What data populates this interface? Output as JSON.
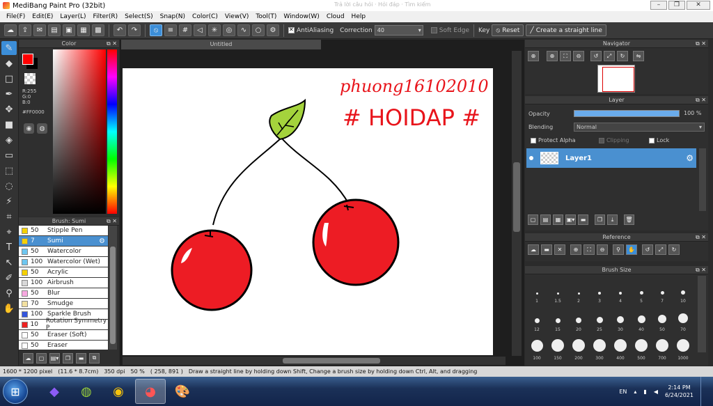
{
  "window": {
    "title": "MediBang Paint Pro (32bit)",
    "ghost_text": "Trả lời câu hỏi · Hỏi đáp · Tìm kiếm"
  },
  "menu": [
    "File(F)",
    "Edit(E)",
    "Layer(L)",
    "Filter(R)",
    "Select(S)",
    "Snap(N)",
    "Color(C)",
    "View(V)",
    "Tool(T)",
    "Window(W)",
    "Cloud",
    "Help"
  ],
  "toolbar": {
    "antialiasing_label": "AntiAliasing",
    "correction_label": "Correction",
    "correction_value": "40",
    "soft_edge_label": "Soft Edge",
    "key_label": "Key",
    "reset_label": "Reset",
    "straight_line_label": "Create a straight line"
  },
  "color_panel": {
    "title": "Color",
    "r": "R:255",
    "g": "G:0",
    "b": "B:0",
    "hex": "#FF0000",
    "foreground": "#FF0000"
  },
  "brush_panel": {
    "title": "Brush: Sumi",
    "items": [
      {
        "size": "50",
        "name": "Stipple Pen",
        "color": "#f5d100"
      },
      {
        "size": "7",
        "name": "Sumi",
        "color": "#f5d100",
        "selected": true
      },
      {
        "size": "50",
        "name": "Watercolor",
        "color": "#6ec6f0"
      },
      {
        "size": "100",
        "name": "Watercolor (Wet)",
        "color": "#6ec6f0"
      },
      {
        "size": "50",
        "name": "Acrylic",
        "color": "#f5d100"
      },
      {
        "size": "100",
        "name": "Airbrush",
        "color": "#d8d8d8"
      },
      {
        "size": "50",
        "name": "Blur",
        "color": "#f7a8e0"
      },
      {
        "size": "70",
        "name": "Smudge",
        "color": "#f2e0a0"
      },
      {
        "size": "100",
        "name": "Sparkle Brush",
        "color": "#3355dd"
      },
      {
        "size": "10",
        "name": "Rotation Symmetry P",
        "color": "#ee2222"
      },
      {
        "size": "50",
        "name": "Eraser (Soft)",
        "color": "#ffffff"
      },
      {
        "size": "50",
        "name": "Eraser",
        "color": "#ffffff"
      }
    ]
  },
  "canvas": {
    "doc_tab": "Untitled",
    "handwriting_line1": "phuong16102010",
    "handwriting_line2": "# HOIDAP #",
    "ink_color": "#e8141b",
    "cherry_color": "#ed1c24"
  },
  "navigator": {
    "title": "Navigator"
  },
  "layer_panel": {
    "title": "Layer",
    "opacity_label": "Opacity",
    "opacity_value": "100 %",
    "opacity": 1.0,
    "blending_label": "Blending",
    "blending_value": "Normal",
    "protect_alpha": "Protect Alpha",
    "clipping": "Clipping",
    "lock": "Lock",
    "layer_name": "Layer1"
  },
  "reference": {
    "title": "Reference"
  },
  "brush_size": {
    "title": "Brush Size",
    "sizes": [
      "1",
      "1.5",
      "2",
      "3",
      "4",
      "5",
      "7",
      "10",
      "12",
      "15",
      "20",
      "25",
      "30",
      "40",
      "50",
      "70",
      "100",
      "150",
      "200",
      "300",
      "400",
      "500",
      "700",
      "1000"
    ]
  },
  "statusbar": {
    "dimensions": "1600 * 1200 pixel",
    "physical": "(11.6 * 8.7cm)",
    "dpi": "350 dpi",
    "zoom": "50 %",
    "coords": "( 258, 891 )",
    "hint": "Draw a straight line by holding down Shift, Change a brush size by holding down Ctrl, Alt, and dragging"
  },
  "taskbar": {
    "lang": "EN",
    "time": "2:14 PM",
    "date": "6/24/2021"
  }
}
